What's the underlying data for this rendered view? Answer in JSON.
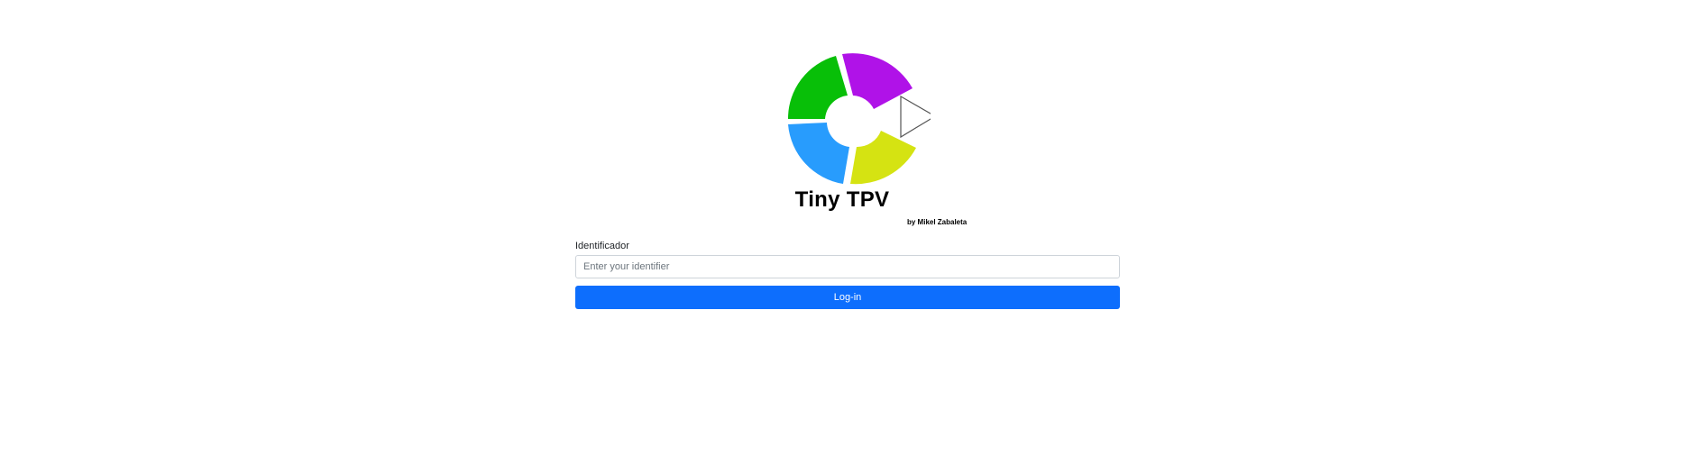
{
  "app": {
    "title": "Tiny TPV",
    "byline": "by Mikel Zabaleta"
  },
  "logo": {
    "icon": "tpv-logo-icon",
    "colors": {
      "green": "#08bf08",
      "purple": "#b012e8",
      "blue": "#289cfd",
      "yellow": "#d5e312",
      "play_outline": "#555555"
    }
  },
  "login": {
    "identifier_label": "Identificador",
    "identifier_placeholder": "Enter your identifier",
    "identifier_value": "",
    "submit_label": "Log-in"
  },
  "colors": {
    "primary": "#0d6efd",
    "input_border": "#ced4da"
  }
}
